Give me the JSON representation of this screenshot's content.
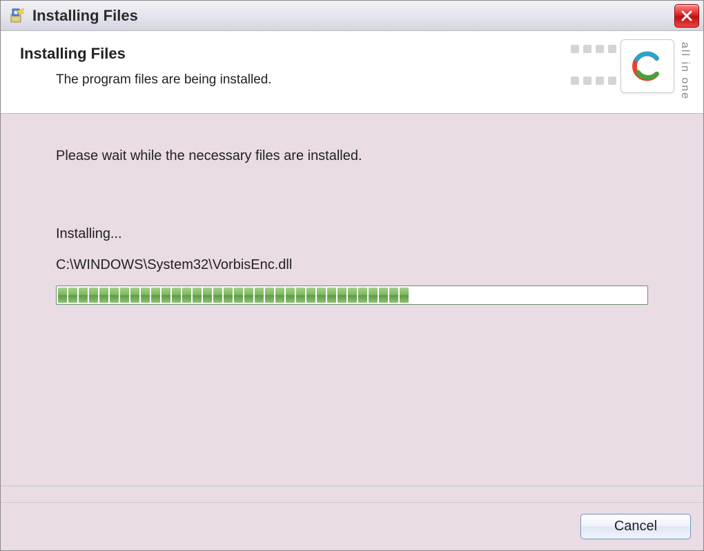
{
  "titlebar": {
    "title": "Installing Files"
  },
  "header": {
    "title": "Installing Files",
    "subtitle": "The program files are being installed.",
    "badge_text": "all in one"
  },
  "body": {
    "wait_text": "Please wait while the necessary files are installed.",
    "installing_label": "Installing...",
    "current_file": "C:\\WINDOWS\\System32\\VorbisEnc.dll",
    "progress_percent": 55,
    "progress_segments": 34
  },
  "footer": {
    "cancel_label": "Cancel"
  }
}
